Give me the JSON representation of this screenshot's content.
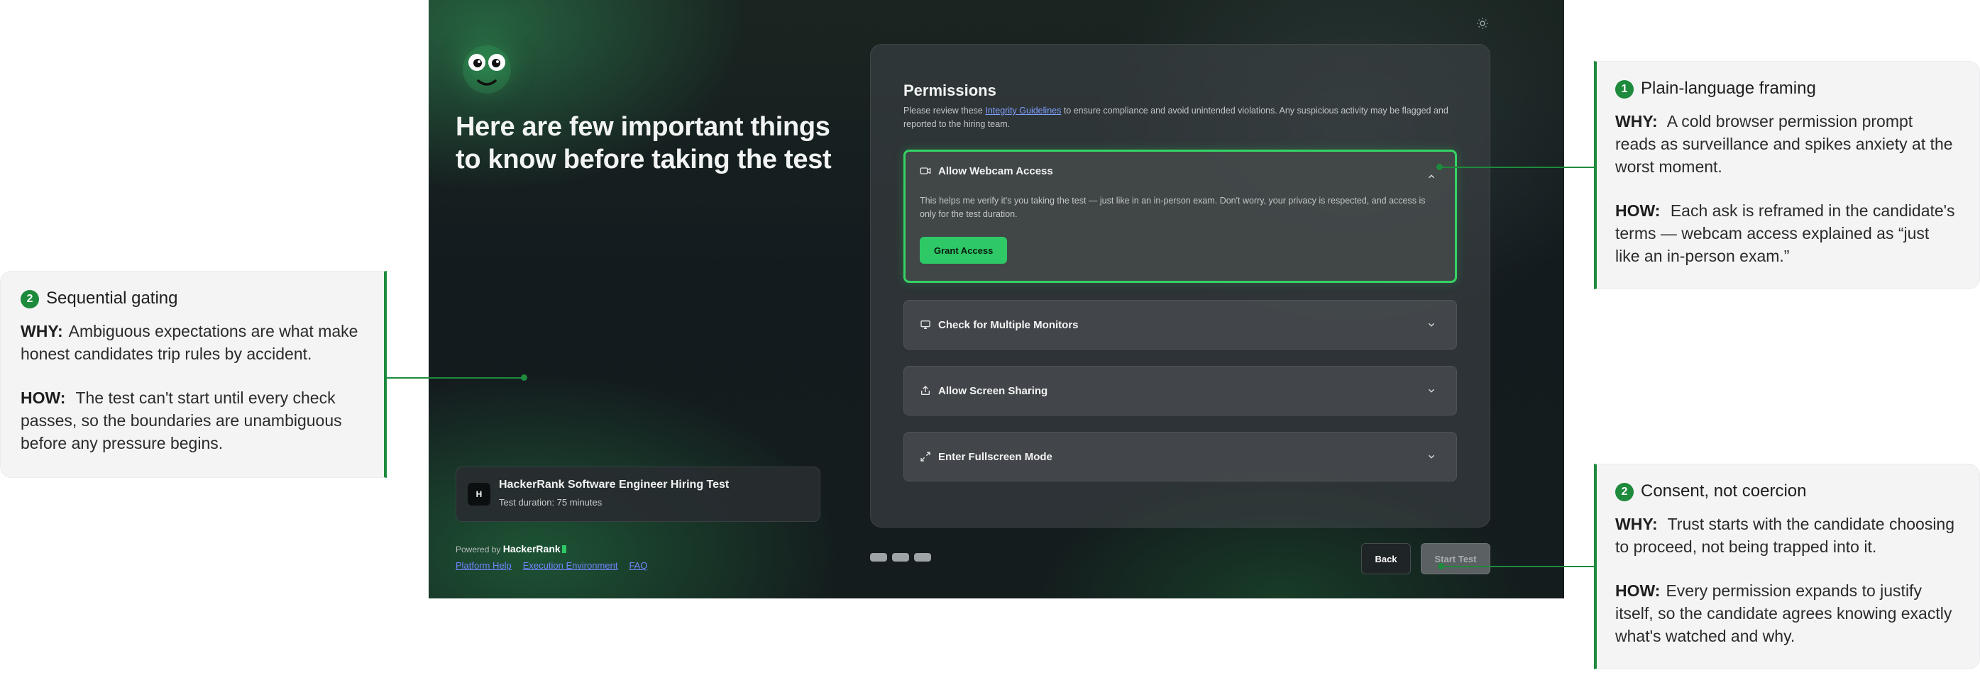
{
  "hero": {
    "title": "Here are few important things to know before taking the test"
  },
  "test_card": {
    "logo_text": "H",
    "name": "HackerRank Software Engineer Hiring Test",
    "duration": "Test duration: 75 minutes"
  },
  "footer": {
    "powered_prefix": "Powered by",
    "powered_brand": "HackerRank",
    "links": [
      "Platform Help",
      "Execution Environment",
      "FAQ"
    ]
  },
  "permissions": {
    "title": "Permissions",
    "desc_before": "Please review these ",
    "desc_link": "Integrity Guidelines",
    "desc_after": " to ensure compliance and avoid unintended violations. Any suspicious activity may be flagged and reported to the hiring team.",
    "items": [
      {
        "label": "Allow Webcam Access",
        "icon": "camera-icon",
        "expanded": true,
        "body": "This helps me verify it's you taking the test — just like in an in-person exam. Don't worry, your privacy is respected, and access is only for the test duration.",
        "button": "Grant Access"
      },
      {
        "label": "Check for Multiple Monitors",
        "icon": "monitor-icon",
        "expanded": false
      },
      {
        "label": "Allow Screen Sharing",
        "icon": "share-icon",
        "expanded": false
      },
      {
        "label": "Enter Fullscreen Mode",
        "icon": "fullscreen-icon",
        "expanded": false
      }
    ]
  },
  "nav": {
    "back": "Back",
    "start": "Start Test"
  },
  "callouts": [
    {
      "num": "1",
      "title": "Plain-language framing",
      "why_label": "WHY:",
      "why": "A cold browser permission prompt reads as surveillance and spikes anxiety at the worst moment.",
      "how_label": "HOW:",
      "how": "Each ask is reframed in the candidate's terms — webcam access explained as “just like an in-person exam.”"
    },
    {
      "num": "2",
      "title": "Sequential gating",
      "why_label": "WHY:",
      "why": "Ambiguous expectations are what make honest candidates trip rules by accident.",
      "how_label": "HOW:",
      "how": "The test can't start until every check passes, so the boundaries are unambiguous before any pressure begins."
    },
    {
      "num": "2",
      "title": "Consent, not coercion",
      "why_label": "WHY:",
      "why": "Trust starts with the candidate choosing to proceed, not being trapped into it.",
      "how_label": "HOW:",
      "how": "Every permission expands to justify itself, so the candidate agrees knowing exactly what's watched and why."
    }
  ],
  "colors": {
    "accent_green": "#2ec866",
    "annotation_green": "#1e8a3c",
    "link_blue": "#7fa0ff"
  }
}
